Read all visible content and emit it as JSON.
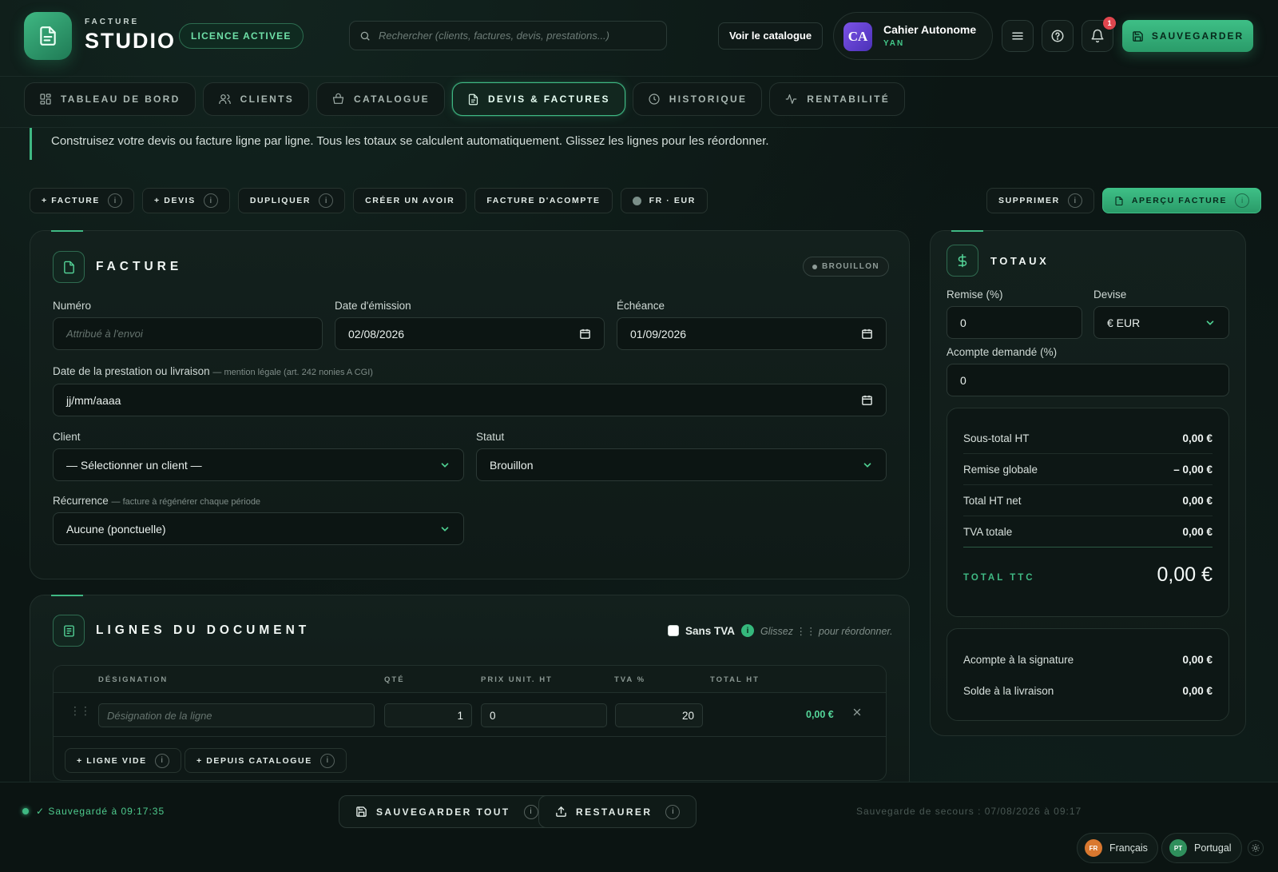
{
  "brand": {
    "small": "FACTURE",
    "big": "STUDIO",
    "license": "LICENCE ACTIVEE"
  },
  "search": {
    "placeholder": "Rechercher (clients, factures, devis, prestations...)"
  },
  "header": {
    "catalog_button": "Voir le catalogue",
    "user_initials": "CA",
    "user_name": "Cahier Autonome",
    "user_sub": "YAN",
    "notification_count": "1",
    "save_label": "SAUVEGARDER"
  },
  "tabs": [
    {
      "label": "TABLEAU DE BORD",
      "icon": "dashboard-icon",
      "active": false
    },
    {
      "label": "CLIENTS",
      "icon": "users-icon",
      "active": false
    },
    {
      "label": "CATALOGUE",
      "icon": "basket-icon",
      "active": false
    },
    {
      "label": "DEVIS & FACTURES",
      "icon": "document-icon",
      "active": true
    },
    {
      "label": "HISTORIQUE",
      "icon": "clock-icon",
      "active": false
    },
    {
      "label": "RENTABILITÉ",
      "icon": "activity-icon",
      "active": false
    }
  ],
  "banner": "Construisez votre devis ou facture ligne par ligne. Tous les totaux se calculent automatiquement. Glissez les lignes pour les réordonner.",
  "actions": {
    "new_invoice": "+ FACTURE",
    "new_quote": "+ DEVIS",
    "duplicate": "DUPLIQUER",
    "credit_note": "CRÉER UN AVOIR",
    "deposit_invoice": "FACTURE D'ACOMPTE",
    "locale": "FR · EUR",
    "delete": "SUPPRIMER",
    "preview": "APERÇU FACTURE",
    "info": "i"
  },
  "invoice": {
    "title": "FACTURE",
    "status_badge": "BROUILLON",
    "number_label": "Numéro",
    "number_placeholder": "Attribué à l'envoi",
    "issue_label": "Date d'émission",
    "issue_value": "02/08/2026",
    "due_label": "Échéance",
    "due_value": "01/09/2026",
    "service_date_label": "Date de la prestation ou livraison",
    "service_date_note": "— mention légale (art. 242 nonies A CGI)",
    "service_date_value": "jj/mm/aaaa",
    "client_label": "Client",
    "client_value": "— Sélectionner un client —",
    "status_label": "Statut",
    "status_value": "Brouillon",
    "recurrence_label": "Récurrence",
    "recurrence_note": "— facture à régénérer chaque période",
    "recurrence_value": "Aucune (ponctuelle)"
  },
  "lines": {
    "title": "LIGNES DU DOCUMENT",
    "no_vat_label": "Sans TVA",
    "drag_hint": "Glissez ⋮⋮ pour réordonner.",
    "headers": [
      "DÉSIGNATION",
      "QTÉ",
      "PRIX UNIT. HT",
      "TVA %",
      "TOTAL HT"
    ],
    "rows": [
      {
        "designation_placeholder": "Désignation de la ligne",
        "qty": "1",
        "price": "0",
        "vat": "20",
        "total": "0,00 €"
      }
    ],
    "add_empty": "+ LIGNE VIDE",
    "add_from_catalog": "+ DEPUIS CATALOGUE"
  },
  "totals": {
    "title": "TOTAUX",
    "discount_label": "Remise (%)",
    "discount_value": "0",
    "currency_label": "Devise",
    "currency_value": "€ EUR",
    "deposit_label": "Acompte demandé (%)",
    "deposit_value": "0",
    "subtotal_label": "Sous-total HT",
    "subtotal_value": "0,00 €",
    "global_discount_label": "Remise globale",
    "global_discount_value": "– 0,00 €",
    "net_label": "Total HT net",
    "net_value": "0,00 €",
    "vat_label": "TVA totale",
    "vat_value": "0,00 €",
    "ttc_label": "TOTAL TTC",
    "ttc_value": "0,00 €",
    "deposit_sign_label": "Acompte à la signature",
    "deposit_sign_value": "0,00 €",
    "balance_label": "Solde à la livraison",
    "balance_value": "0,00 €"
  },
  "footer": {
    "saved_status": "✓ Sauvegardé à 09:17:35",
    "save_all": "SAUVEGARDER TOUT",
    "restore": "RESTAURER",
    "backup": "Sauvegarde de secours : 07/08/2026 à 09:17",
    "languages": [
      {
        "code": "FR",
        "label": "Français",
        "color": "#d9782f"
      },
      {
        "code": "PT",
        "label": "Portugal",
        "color": "#2f8f5c"
      }
    ]
  },
  "colors": {
    "accent": "#3fb883",
    "background": "#0c1614",
    "notification": "#e0464e"
  }
}
